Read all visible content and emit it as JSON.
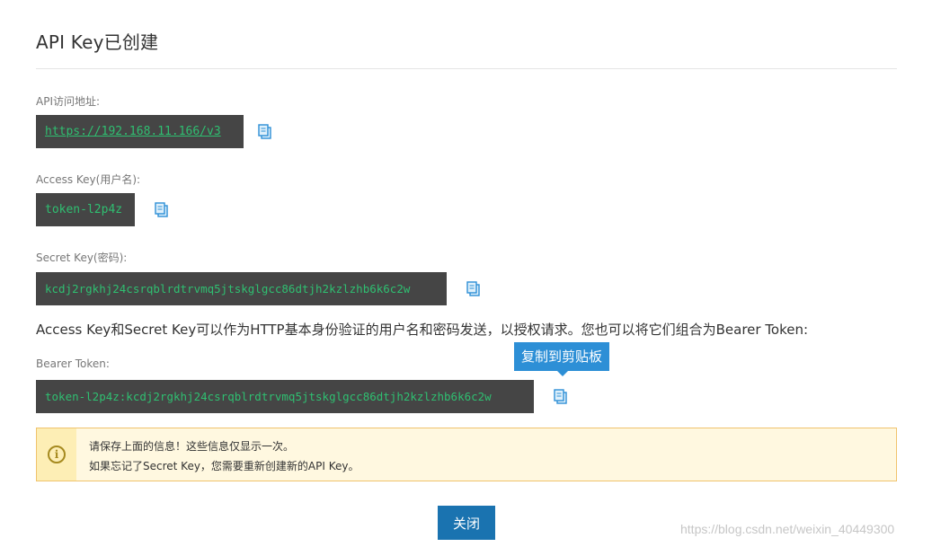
{
  "title": "API Key已创建",
  "fields": {
    "api_url": {
      "label": "API访问地址:",
      "value": "https://192.168.11.166/v3"
    },
    "access_key": {
      "label": "Access Key(用户名):",
      "value": "token-l2p4z"
    },
    "secret_key": {
      "label": "Secret Key(密码):",
      "value": "kcdj2rgkhj24csrqblrdtrvmq5jtskglgcc86dtjh2kzlzhb6k6c2w"
    },
    "bearer_token": {
      "label": "Bearer Token:",
      "value": "token-l2p4z:kcdj2rgkhj24csrqblrdtrvmq5jtskglgcc86dtjh2kzlzhb6k6c2w"
    }
  },
  "info_text": "Access Key和Secret Key可以作为HTTP基本身份验证的用户名和密码发送，以授权请求。您也可以将它们组合为Bearer Token:",
  "tooltip": "复制到剪贴板",
  "warning": {
    "icon": "info-circle-icon",
    "line1": "请保存上面的信息！这些信息仅显示一次。",
    "line2": "如果忘记了Secret Key，您需要重新创建新的API Key。"
  },
  "close_label": "关闭",
  "watermark": "https://blog.csdn.net/weixin_40449300",
  "colors": {
    "code_bg": "#454545",
    "code_text": "#2fbf71",
    "accent": "#1a73b0",
    "tooltip_bg": "#2d8fd6",
    "warning_bg": "#fff8e0",
    "warning_border": "#f0c36d"
  }
}
